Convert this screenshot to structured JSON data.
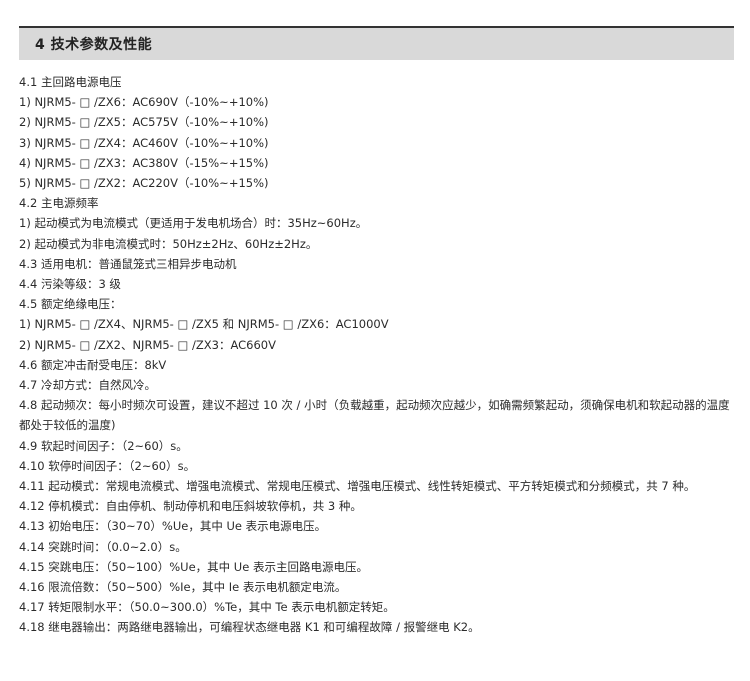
{
  "section": {
    "title": "4 技术参数及性能"
  },
  "lines": [
    "4.1 主回路电源电压",
    "1) NJRM5- □ /ZX6：AC690V（-10%~+10%)",
    "2)  NJRM5- □ /ZX5：AC575V（-10%~+10%)",
    "3)  NJRM5- □ /ZX4：AC460V（-10%~+10%)",
    "4)  NJRM5- □ /ZX3：AC380V（-15%~+15%)",
    "5)  NJRM5- □ /ZX2：AC220V（-10%~+15%)",
    "4.2 主电源频率",
    "1)  起动模式为电流模式（更适用于发电机场合）时：35Hz~60Hz。",
    "2)  起动模式为非电流模式时：50Hz±2Hz、60Hz±2Hz。",
    "4.3 适用电机：普通鼠笼式三相异步电动机",
    "4.4 污染等级：3 级",
    "4.5 额定绝缘电压：",
    "1)  NJRM5- □ /ZX4、NJRM5- □ /ZX5 和 NJRM5- □ /ZX6：AC1000V",
    "2)  NJRM5- □ /ZX2、NJRM5- □ /ZX3：AC660V",
    "4.6 额定冲击耐受电压：8kV",
    "4.7 冷却方式：自然风冷。",
    "4.8  起动频次：每小时频次可设置，建议不超过 10 次 / 小时（负载越重，起动频次应越少，如确需频繁起动，须确保电机和软起动器的温度都处于较低的温度)",
    "4.9 软起时间因子：（2~60）s。",
    "4.10 软停时间因子：（2~60）s。",
    "4.11 起动模式：常规电流模式、增强电流模式、常规电压模式、增强电压模式、线性转矩模式、平方转矩模式和分频模式，共 7 种。",
    "4.12 停机模式：自由停机、制动停机和电压斜坡软停机，共 3 种。",
    "4.13 初始电压：（30~70）%Ue，其中 Ue 表示电源电压。",
    "4.14 突跳时间：（0.0~2.0）s。",
    "4.15 突跳电压：（50~100）%Ue，其中 Ue 表示主回路电源电压。",
    "4.16 限流倍数：（50~500）%Ie，其中 Ie 表示电机额定电流。",
    "4.17 转矩限制水平：（50.0~300.0）%Te，其中 Te 表示电机额定转矩。",
    "4.18 继电器输出：两路继电器输出，可编程状态继电器 K1 和可编程故障 / 报警继电 K2。"
  ]
}
